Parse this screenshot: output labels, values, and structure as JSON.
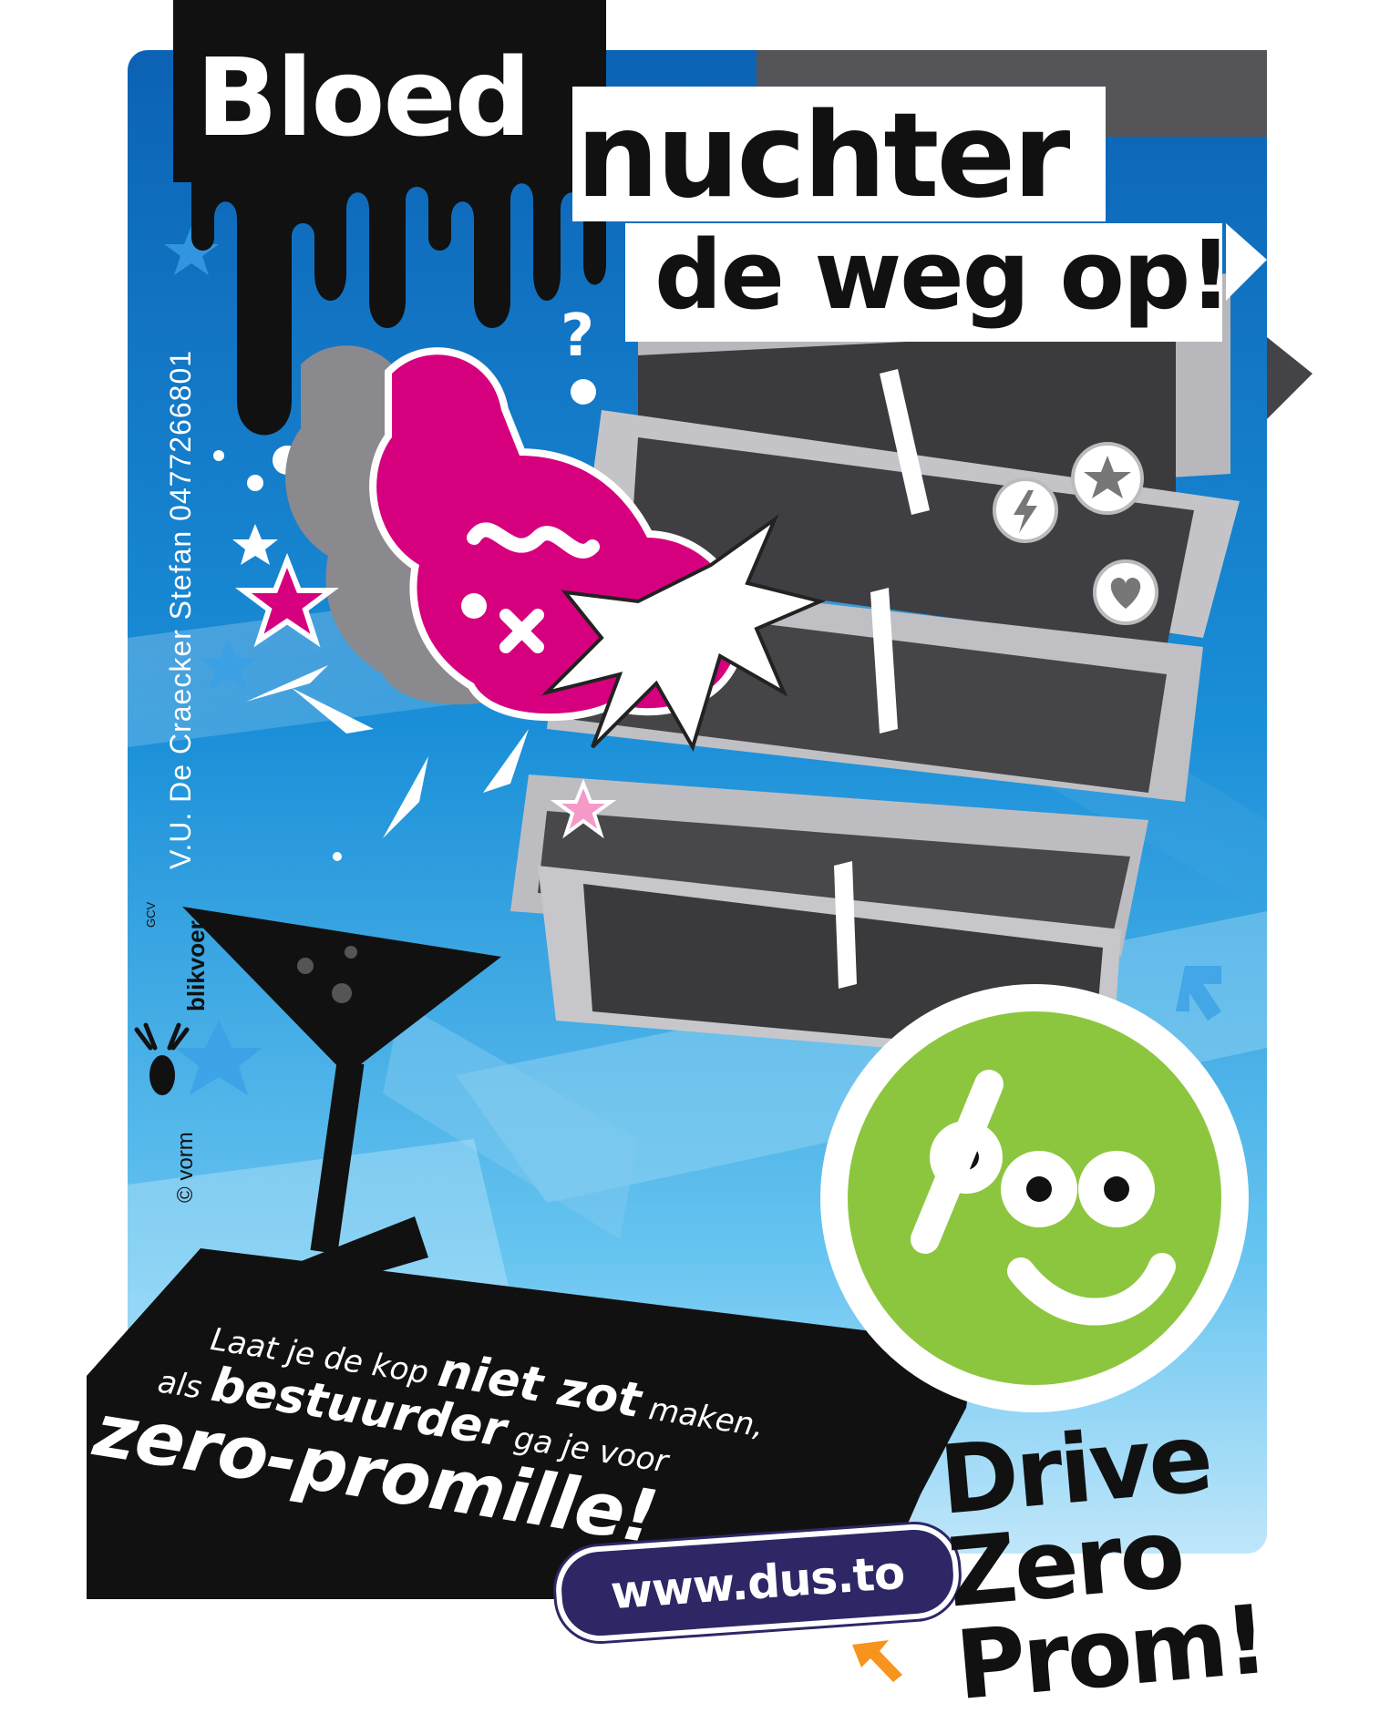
{
  "headline": {
    "word1": "Bloed",
    "word2": "nuchter",
    "line2": "de weg op!"
  },
  "credits": {
    "vu": "V.U. De Craecker Stefan   0477266801",
    "vorm": "© vorm",
    "blikvoer": "blikvoer",
    "gcv": "GCV"
  },
  "slogan": {
    "line1_a": "Laat je de kop ",
    "line1_b": "niet zot",
    "line1_c": " maken,",
    "line2_a": "als ",
    "line2_b": "bestuurder",
    "line2_c": " ga je voor",
    "line3": "zero-promille!"
  },
  "url": "www.dus.to",
  "tagline": [
    "Drive",
    "Zero",
    "Prom!"
  ],
  "badge_symbol": "%o",
  "colors": {
    "sky_blue": "#1a8fd8",
    "deep_blue": "#0b5fa8",
    "magenta": "#d6007e",
    "green": "#8cc63f",
    "black": "#111111",
    "navy_pill": "#2d2766",
    "arrow_orange": "#f7941d"
  },
  "icons": [
    "question-mark-icon",
    "lightning-icon",
    "star-icon",
    "heart-icon",
    "cocktail-glass-icon",
    "deer-logo-icon",
    "cursor-arrow-icon"
  ]
}
